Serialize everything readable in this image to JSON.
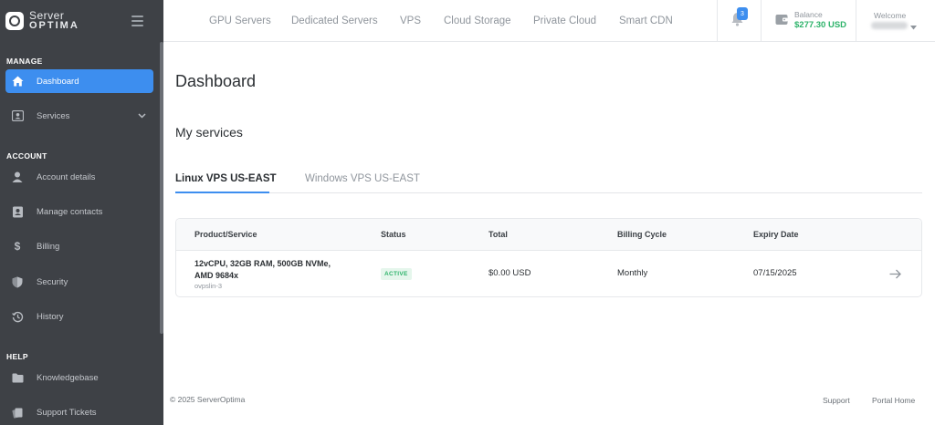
{
  "brand": {
    "line1": "Server",
    "line2": "OPTIMA"
  },
  "sidebar": {
    "sections": [
      {
        "title": "MANAGE"
      },
      {
        "title": "ACCOUNT"
      },
      {
        "title": "HELP"
      }
    ],
    "items": [
      {
        "label": "Dashboard",
        "icon": "home-icon",
        "active": true
      },
      {
        "label": "Services",
        "icon": "id-card-icon",
        "has_submenu": true
      },
      {
        "label": "Account details",
        "icon": "user-icon"
      },
      {
        "label": "Manage contacts",
        "icon": "contacts-icon"
      },
      {
        "label": "Billing",
        "icon": "dollar-icon"
      },
      {
        "label": "Security",
        "icon": "shield-icon"
      },
      {
        "label": "History",
        "icon": "history-icon"
      },
      {
        "label": "Knowledgebase",
        "icon": "folder-icon"
      },
      {
        "label": "Support Tickets",
        "icon": "tickets-icon"
      }
    ]
  },
  "topnav": {
    "links": [
      "GPU Servers",
      "Dedicated Servers",
      "VPS",
      "Cloud Storage",
      "Private Cloud",
      "Smart CDN"
    ],
    "notifications_count": "3",
    "balance_label": "Balance",
    "balance_value": "$277.30 USD",
    "welcome_label": "Welcome"
  },
  "main": {
    "title": "Dashboard",
    "subtitle": "My services",
    "tabs": [
      {
        "label": "Linux VPS US-EAST",
        "active": true
      },
      {
        "label": "Windows VPS US-EAST",
        "active": false
      }
    ],
    "table": {
      "headers": [
        "Product/Service",
        "Status",
        "Total",
        "Billing Cycle",
        "Expiry Date"
      ],
      "rows": [
        {
          "product_line1": "12vCPU, 32GB RAM, 500GB NVMe,",
          "product_line2": "AMD 9684x",
          "hostname": "ovpslin-3",
          "status": "ACTIVE",
          "total": "$0.00 USD",
          "billing_cycle": "Monthly",
          "expiry_date": "07/15/2025"
        }
      ]
    }
  },
  "footer": {
    "copyright": "© 2025 ServerOptima",
    "links": [
      "Support",
      "Portal Home"
    ]
  },
  "colors": {
    "sidebar_bg": "#3e4146",
    "accent": "#3d8eef",
    "success": "#2db36a"
  }
}
